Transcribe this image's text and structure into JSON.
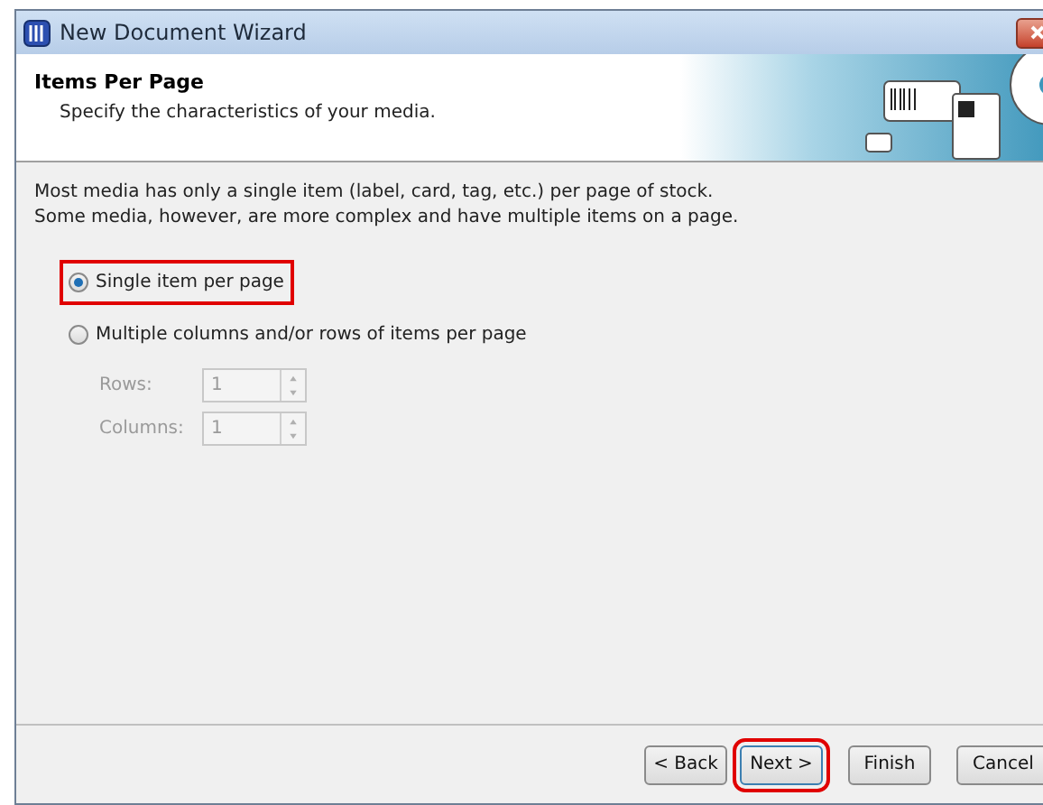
{
  "window": {
    "title": "New Document Wizard"
  },
  "header": {
    "title": "Items Per Page",
    "subtitle": "Specify the characteristics of your media."
  },
  "intro": "Most media has only a single item (label, card, tag, etc.) per page of stock.\nSome media, however, are more complex and have multiple items on a page.",
  "options": [
    {
      "label": "Single item per page",
      "selected": true,
      "highlighted": true
    },
    {
      "label": "Multiple columns and/or rows of items per page",
      "selected": false,
      "highlighted": false
    }
  ],
  "spinners": [
    {
      "label": "Rows:",
      "value": "1",
      "disabled": true
    },
    {
      "label": "Columns:",
      "value": "1",
      "disabled": true
    }
  ],
  "buttons": [
    {
      "label": "< Back",
      "highlighted": false
    },
    {
      "label": "Next >",
      "highlighted": true
    },
    {
      "label": "Finish",
      "highlighted": false
    },
    {
      "label": "Cancel",
      "highlighted": false
    }
  ]
}
